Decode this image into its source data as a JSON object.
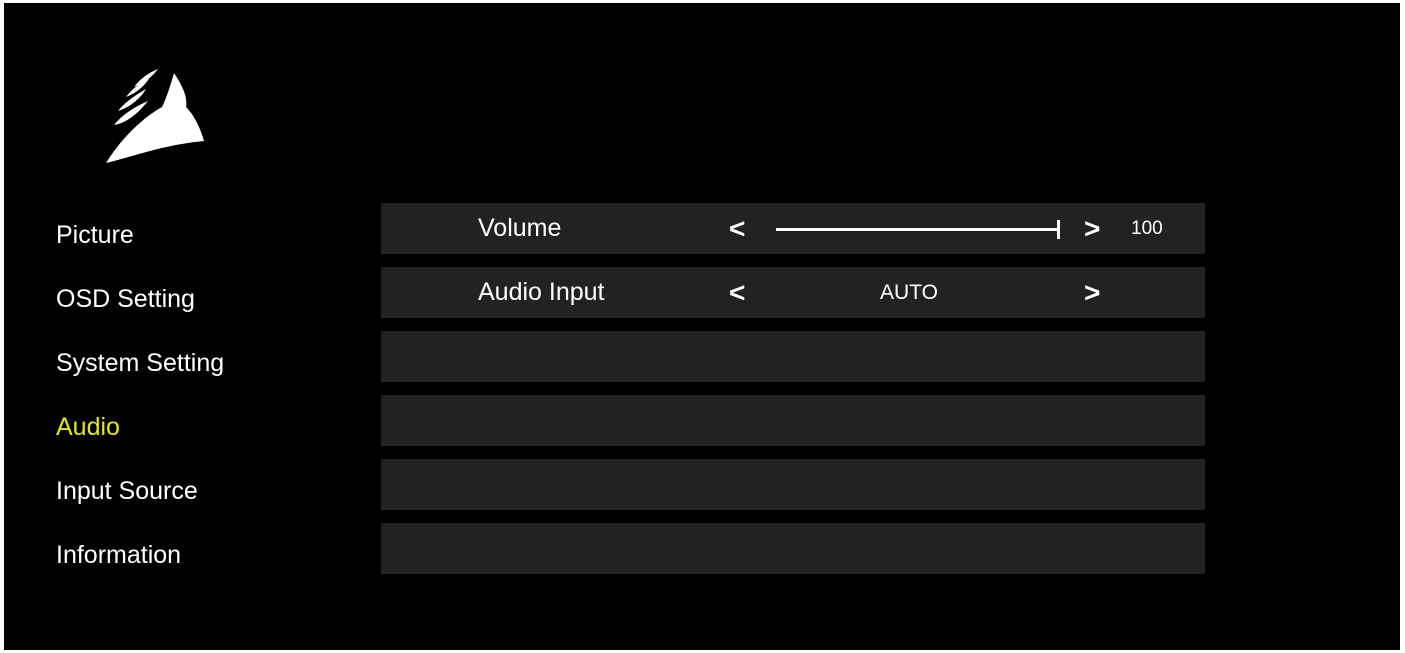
{
  "logo": {
    "icon": "sails-logo-icon"
  },
  "menu": {
    "active_color": "#e6e61a",
    "items": [
      {
        "label": "Picture"
      },
      {
        "label": "OSD Setting"
      },
      {
        "label": "System Setting"
      },
      {
        "label": "Audio",
        "active": true
      },
      {
        "label": "Input Source"
      },
      {
        "label": "Information"
      }
    ]
  },
  "settings": {
    "volume": {
      "label": "Volume",
      "left_arrow": "<",
      "right_arrow": ">",
      "value": "100",
      "level": 100
    },
    "audio_input": {
      "label": "Audio Input",
      "left_arrow": "<",
      "right_arrow": ">",
      "value": "AUTO"
    }
  }
}
